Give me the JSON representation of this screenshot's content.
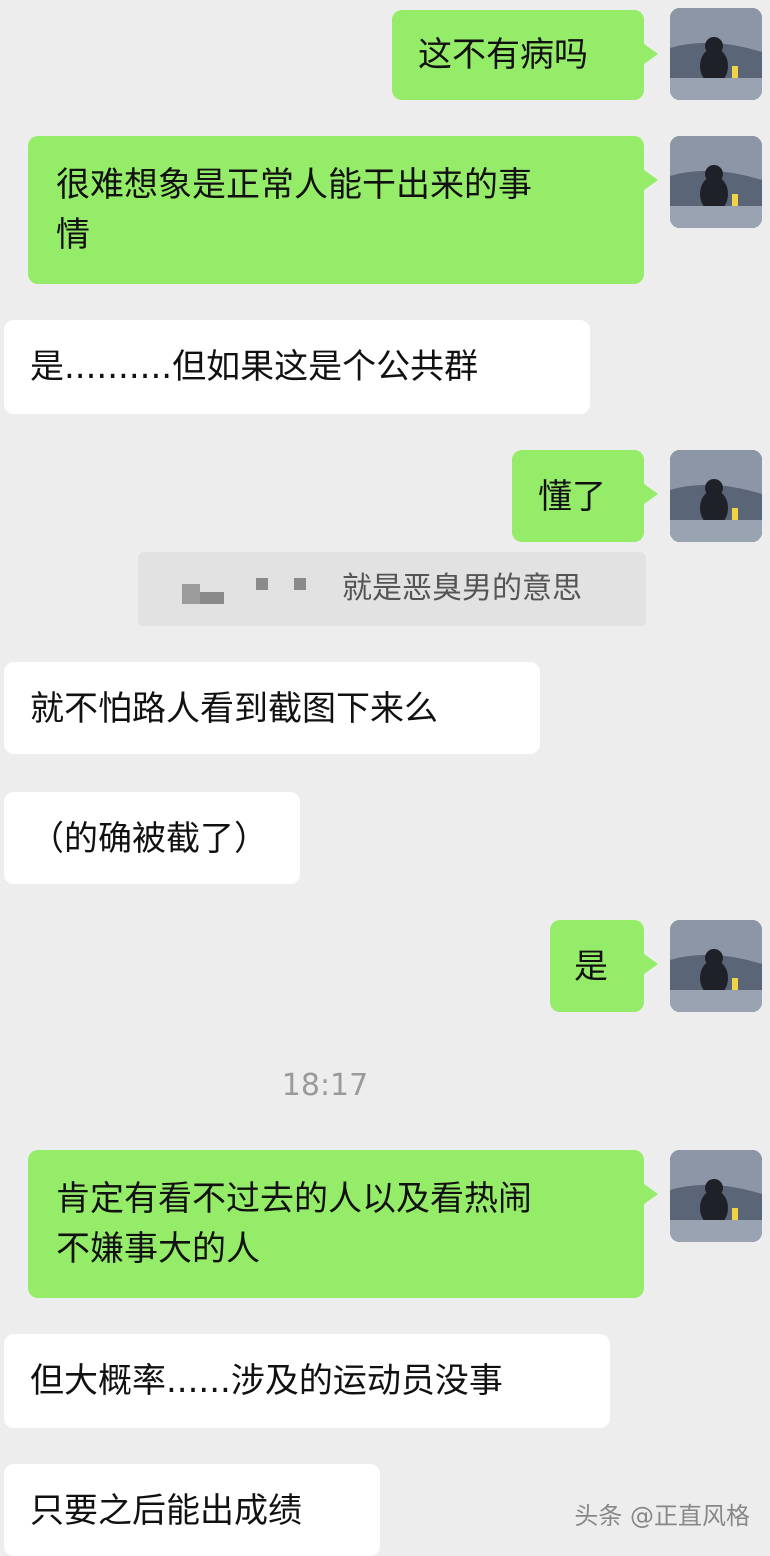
{
  "messages": [
    {
      "side": "right",
      "text": "这不有病吗"
    },
    {
      "side": "right",
      "line1": "很难想象是正常人能干出来的事",
      "line2": "情"
    },
    {
      "side": "left",
      "text": "是..........但如果这是个公共群"
    },
    {
      "side": "right",
      "text": "懂了"
    },
    {
      "side": "left",
      "text": "就不怕路人看到截图下来么"
    },
    {
      "side": "left",
      "text": "（的确被截了）"
    },
    {
      "side": "right",
      "text": "是"
    },
    {
      "side": "right",
      "line1": "肯定有看不过去的人以及看热闹",
      "line2": "不嫌事大的人"
    },
    {
      "side": "left",
      "text": "但大概率......涉及的运动员没事"
    },
    {
      "side": "left",
      "text": "只要之后能出成绩"
    }
  ],
  "quote": {
    "text": "就是恶臭男的意思"
  },
  "timestamp": "18:17",
  "watermark": "头条 @正直风格",
  "colors": {
    "background": "#ededed",
    "sent_bubble": "#95ec69",
    "received_bubble": "#ffffff"
  },
  "avatar_icon": "avatar-icon"
}
